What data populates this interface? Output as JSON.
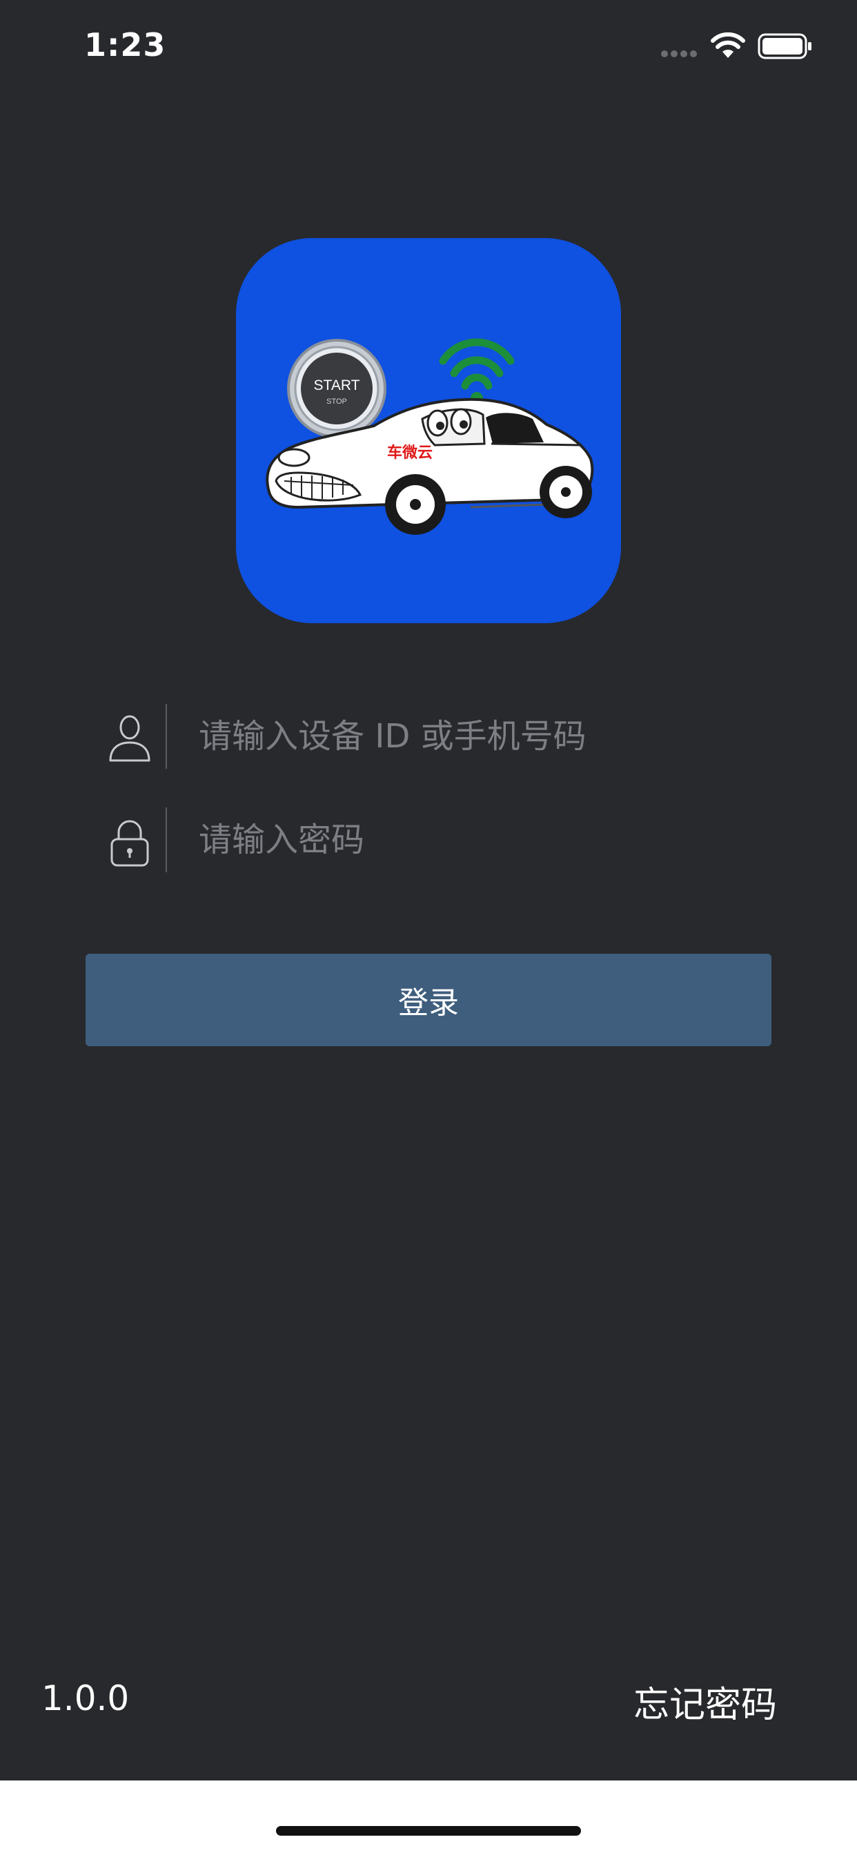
{
  "status_bar": {
    "time": "1:23"
  },
  "app_icon": {
    "button_text_primary": "START",
    "button_text_secondary": "STOP",
    "brand_text": "车微云",
    "background_color": "#0f51e0"
  },
  "login_form": {
    "account_field": {
      "placeholder": "请输入设备 ID 或手机号码",
      "value": "",
      "icon": "user-icon"
    },
    "password_field": {
      "placeholder": "请输入密码",
      "value": "",
      "icon": "lock-icon"
    },
    "login_button_label": "登录",
    "button_color": "#3f5e7d"
  },
  "footer": {
    "version": "1.0.0",
    "forgot_password_label": "忘记密码"
  },
  "colors": {
    "background": "#28292d",
    "placeholder": "#7d7f85"
  }
}
